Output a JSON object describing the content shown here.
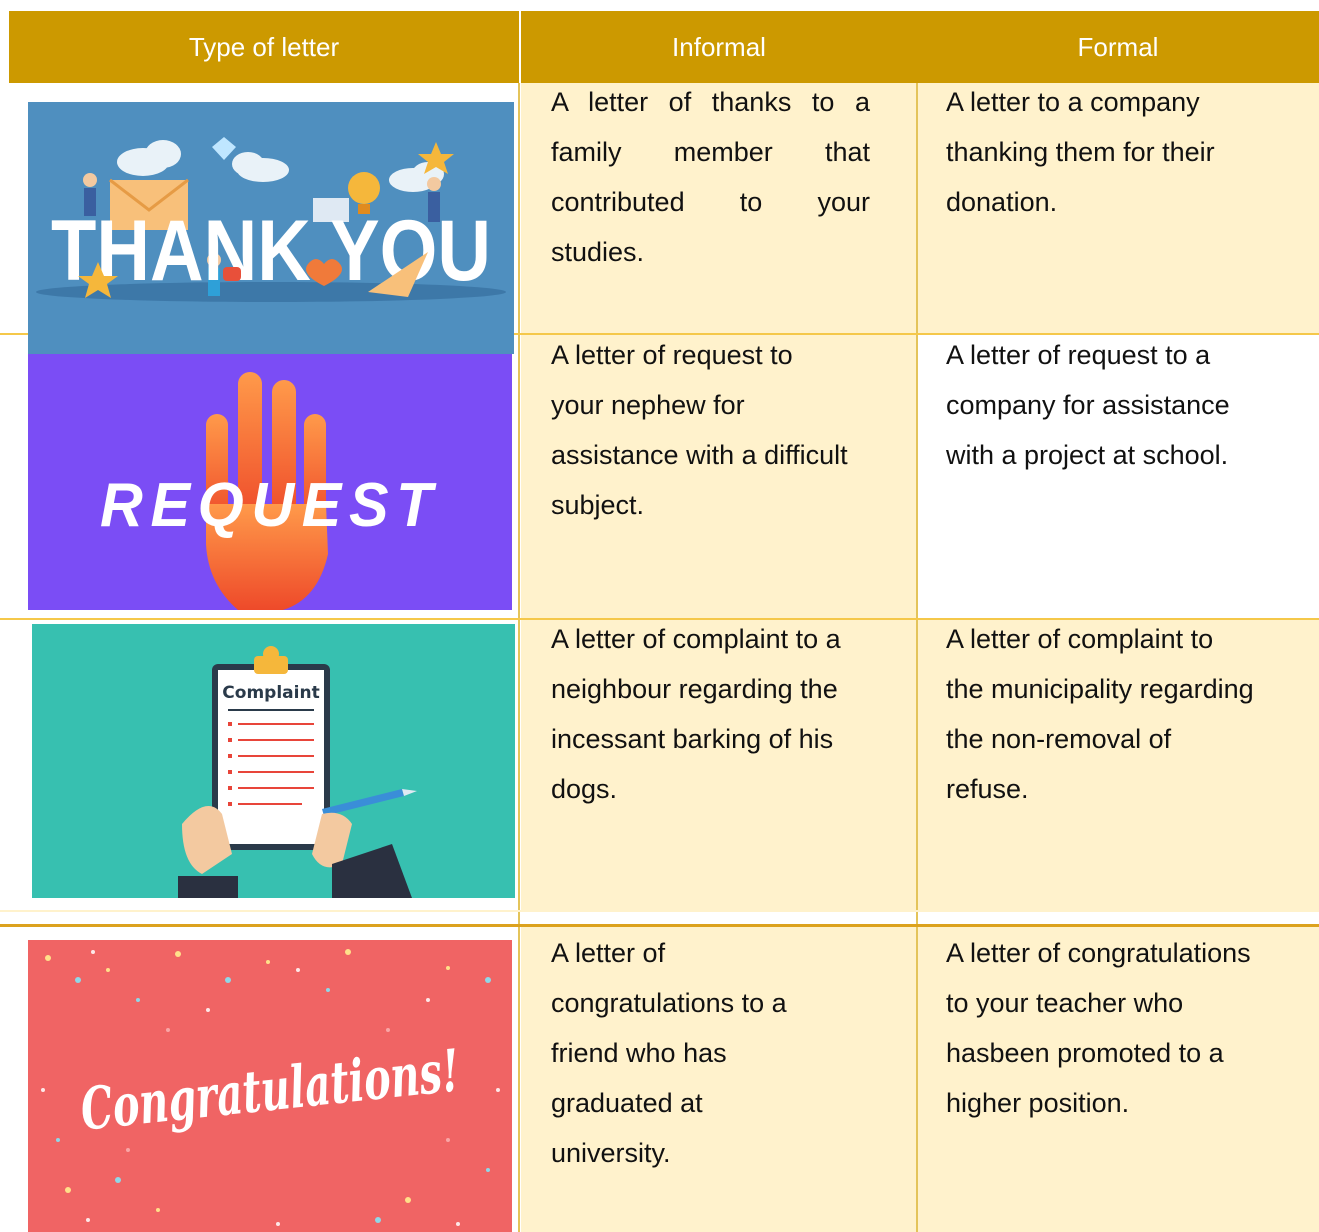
{
  "header": {
    "type": "Type of letter",
    "informal": "Informal",
    "formal": "Formal"
  },
  "rows": [
    {
      "image_label": "THANK YOU",
      "informal": "A letter of thanks to a family member that contributed to your studies.",
      "formal": "A letter to a company thanking them for their donation."
    },
    {
      "image_label": "REQUEST",
      "informal": "A letter of request to your nephew for assistance with a difficult subject.",
      "formal": "A letter of request to a company for assistance with a project at school."
    },
    {
      "image_label": "Complaint",
      "informal": "A letter of complaint to a neighbour regarding the incessant barking of his dogs.",
      "formal": "A letter of complaint to the municipality regarding the non-removal of refuse."
    },
    {
      "image_label": "Congratulations!",
      "informal": "A letter of congratulations to a friend who has graduated at university.",
      "formal": "A letter of congratulations to your teacher who hasbeen promoted to a higher position."
    }
  ],
  "colors": {
    "header_bg": "#cc9900",
    "cell_bg": "#fff2cc",
    "thank_you_bg": "#4f8fbf",
    "request_bg": "#7b4df5",
    "complaint_bg": "#37c0b0",
    "congrats_bg": "#f06464"
  }
}
